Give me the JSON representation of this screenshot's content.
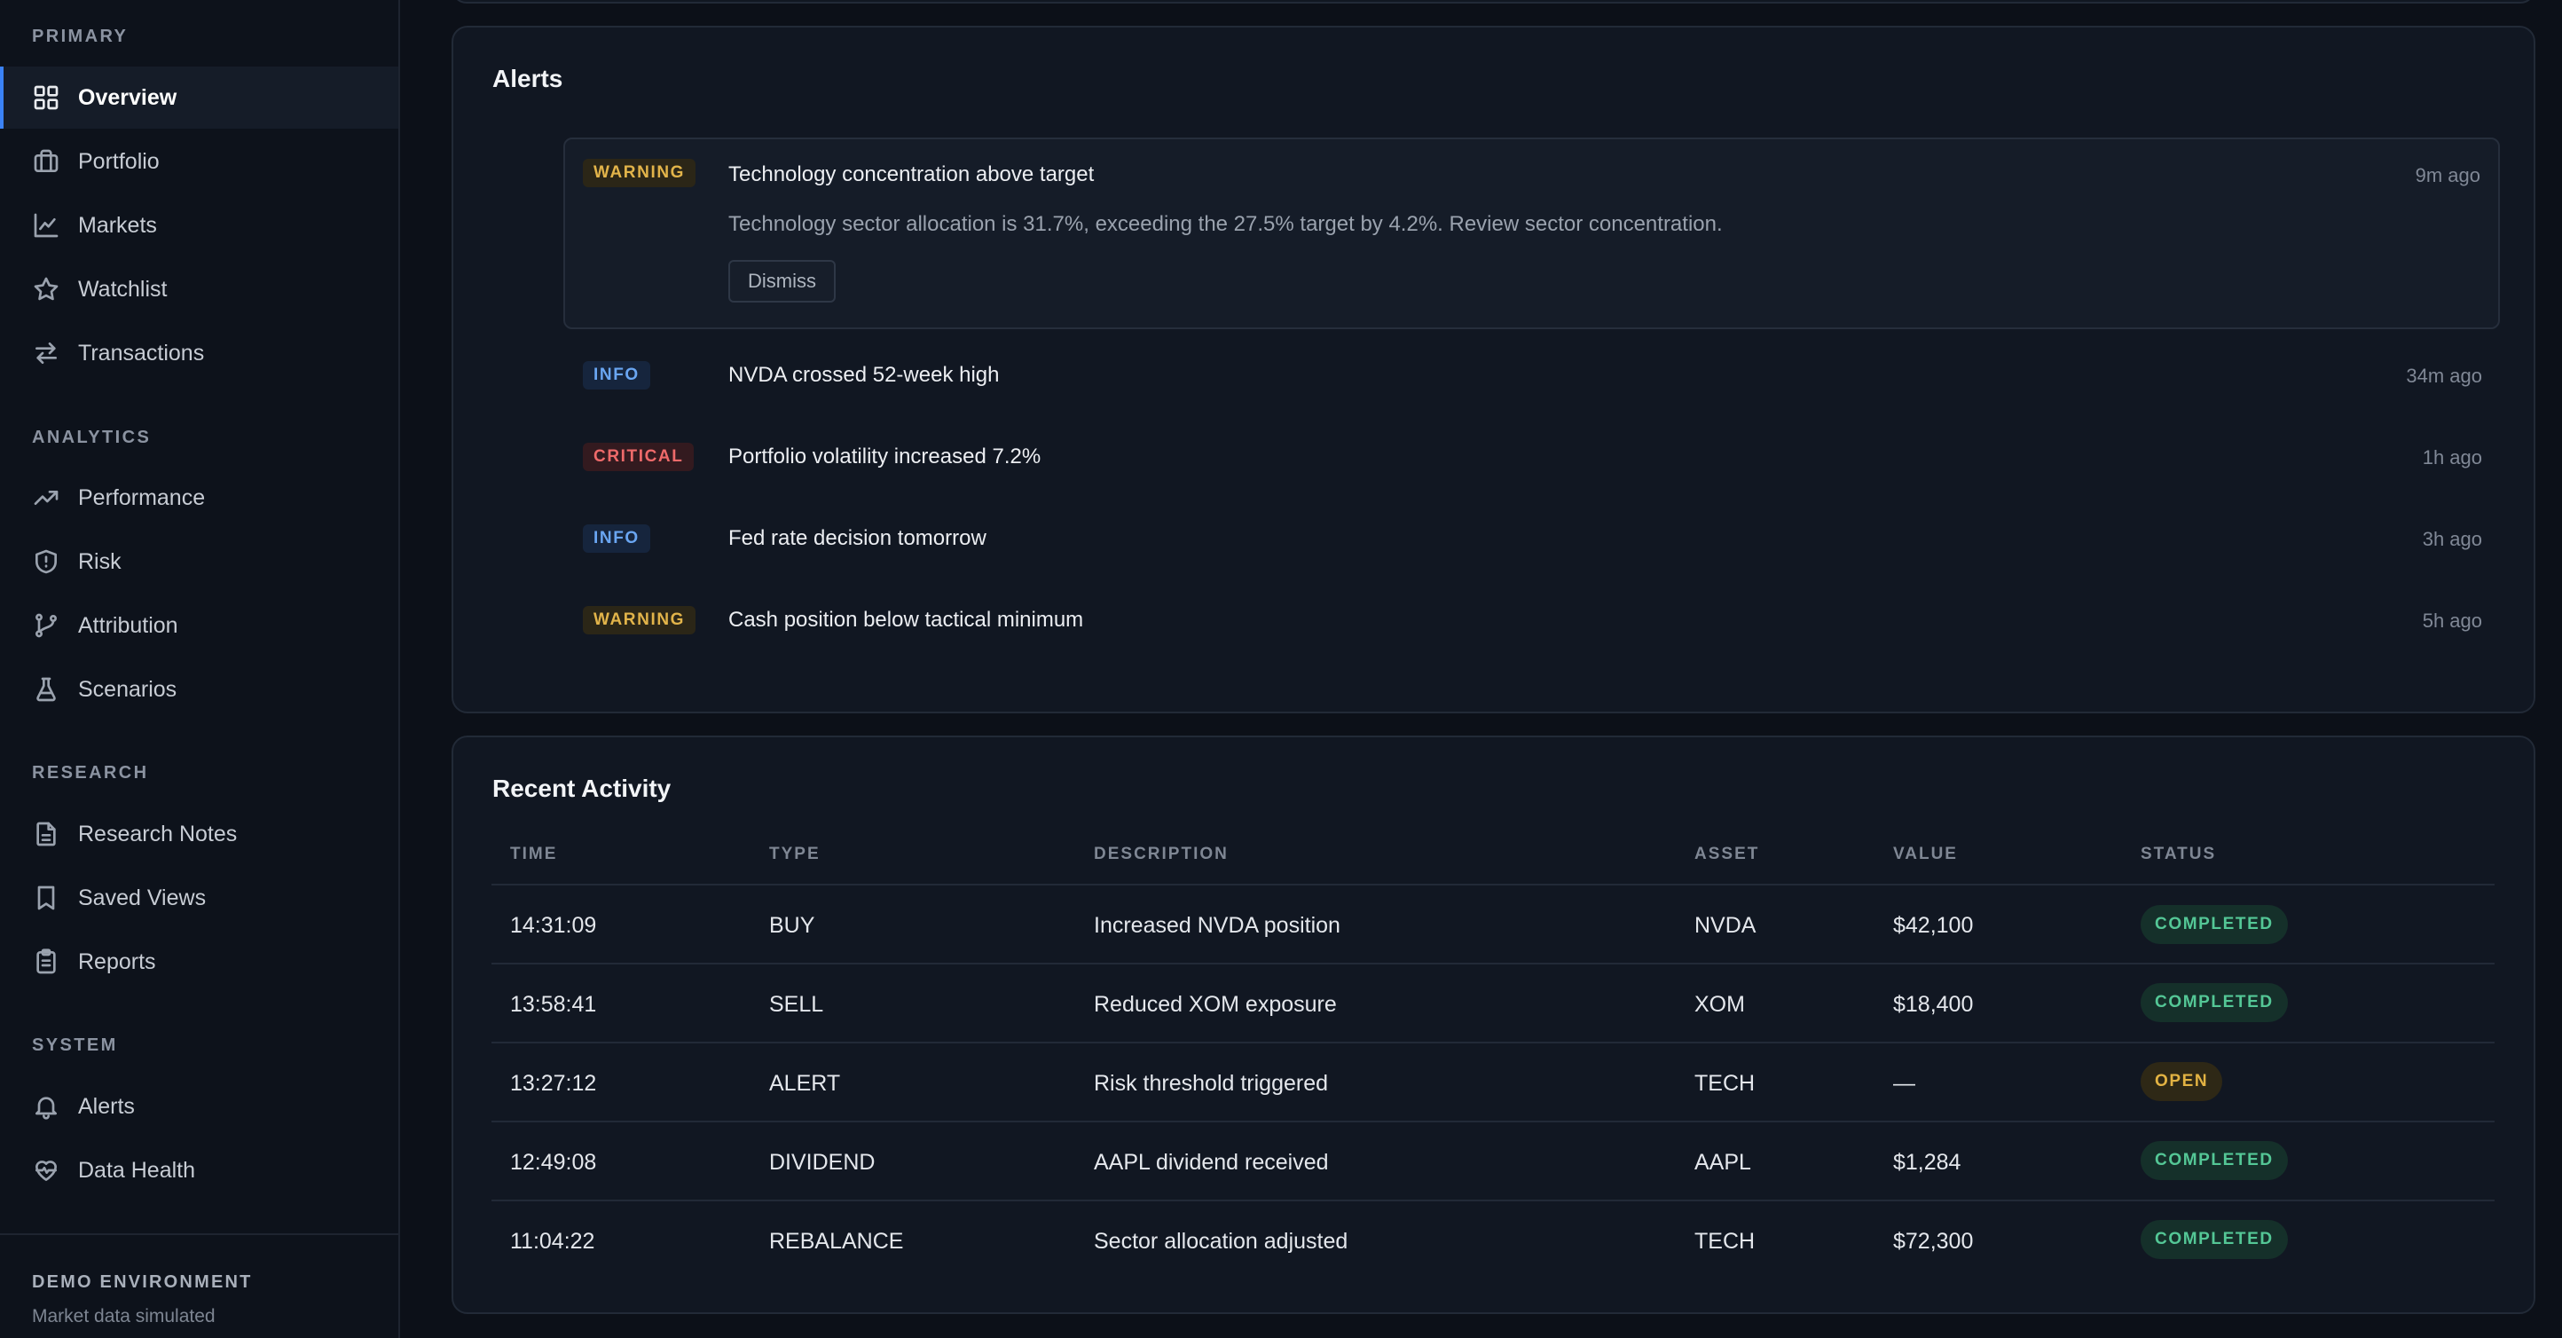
{
  "sidebar": {
    "sections": [
      {
        "title": "PRIMARY",
        "items": [
          {
            "label": "Overview",
            "icon": "grid-icon",
            "active": true
          },
          {
            "label": "Portfolio",
            "icon": "briefcase-icon"
          },
          {
            "label": "Markets",
            "icon": "line-chart-icon"
          },
          {
            "label": "Watchlist",
            "icon": "star-icon"
          },
          {
            "label": "Transactions",
            "icon": "arrows-left-right-icon"
          }
        ]
      },
      {
        "title": "ANALYTICS",
        "items": [
          {
            "label": "Performance",
            "icon": "trending-up-icon"
          },
          {
            "label": "Risk",
            "icon": "shield-icon"
          },
          {
            "label": "Attribution",
            "icon": "git-branch-icon"
          },
          {
            "label": "Scenarios",
            "icon": "flask-icon"
          }
        ]
      },
      {
        "title": "RESEARCH",
        "items": [
          {
            "label": "Research Notes",
            "icon": "document-icon"
          },
          {
            "label": "Saved Views",
            "icon": "bookmark-icon"
          },
          {
            "label": "Reports",
            "icon": "clipboard-icon"
          }
        ]
      },
      {
        "title": "SYSTEM",
        "items": [
          {
            "label": "Alerts",
            "icon": "bell-icon"
          },
          {
            "label": "Data Health",
            "icon": "heart-pulse-icon"
          }
        ]
      }
    ],
    "footer": {
      "title": "DEMO ENVIRONMENT",
      "subtitle": "Market data simulated"
    }
  },
  "alerts": {
    "title": "Alerts",
    "expanded": {
      "severity": "WARNING",
      "title": "Technology concentration above target",
      "time": "9m ago",
      "description": "Technology sector allocation is 31.7%, exceeding the 27.5% target by 4.2%. Review sector concentration.",
      "dismiss_label": "Dismiss"
    },
    "items": [
      {
        "severity": "INFO",
        "title": "NVDA crossed 52-week high",
        "time": "34m ago"
      },
      {
        "severity": "CRITICAL",
        "title": "Portfolio volatility increased 7.2%",
        "time": "1h ago"
      },
      {
        "severity": "INFO",
        "title": "Fed rate decision tomorrow",
        "time": "3h ago"
      },
      {
        "severity": "WARNING",
        "title": "Cash position below tactical minimum",
        "time": "5h ago"
      }
    ]
  },
  "activity": {
    "title": "Recent Activity",
    "columns": [
      "TIME",
      "TYPE",
      "DESCRIPTION",
      "ASSET",
      "VALUE",
      "STATUS"
    ],
    "rows": [
      {
        "time": "14:31:09",
        "type": "BUY",
        "description": "Increased NVDA position",
        "asset": "NVDA",
        "value": "$42,100",
        "status": "COMPLETED"
      },
      {
        "time": "13:58:41",
        "type": "SELL",
        "description": "Reduced XOM exposure",
        "asset": "XOM",
        "value": "$18,400",
        "status": "COMPLETED"
      },
      {
        "time": "13:27:12",
        "type": "ALERT",
        "description": "Risk threshold triggered",
        "asset": "TECH",
        "value": "—",
        "status": "OPEN"
      },
      {
        "time": "12:49:08",
        "type": "DIVIDEND",
        "description": "AAPL dividend received",
        "asset": "AAPL",
        "value": "$1,284",
        "status": "COMPLETED"
      },
      {
        "time": "11:04:22",
        "type": "REBALANCE",
        "description": "Sector allocation adjusted",
        "asset": "TECH",
        "value": "$72,300",
        "status": "COMPLETED"
      }
    ]
  },
  "colors": {
    "accent": "#3b82f6",
    "warning": "#e2b44a",
    "info": "#6aa6f2",
    "critical": "#ee6a6a",
    "success": "#54c796"
  }
}
